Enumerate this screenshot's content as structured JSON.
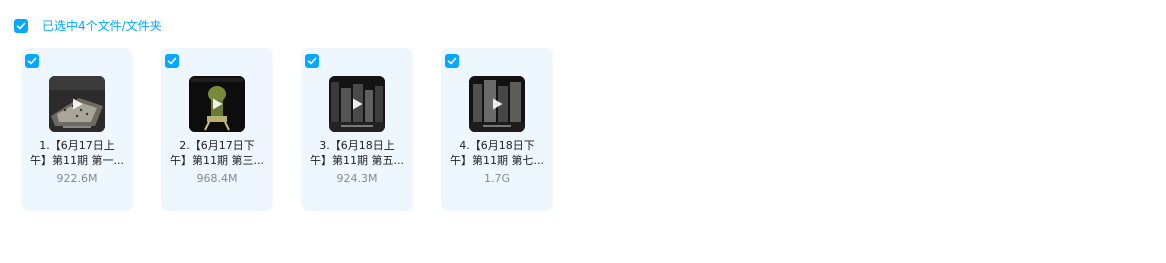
{
  "toolbar": {
    "selection_label": "已选中4个文件/文件夹",
    "all_checked": true
  },
  "colors": {
    "accent": "#06a7ff",
    "card_bg": "#eef7fe",
    "size_text": "#818999"
  },
  "files": [
    {
      "name_line1": "1.【6月17日上",
      "name_line2": "午】第11期 第一...",
      "size": "922.6M",
      "checked": true,
      "type": "video",
      "thumb_icon": "video-thumbnail-icon"
    },
    {
      "name_line1": "2.【6月17日下",
      "name_line2": "午】第11期 第三...",
      "size": "968.4M",
      "checked": true,
      "type": "video",
      "thumb_icon": "video-thumbnail-icon"
    },
    {
      "name_line1": "3.【6月18日上",
      "name_line2": "午】第11期 第五...",
      "size": "924.3M",
      "checked": true,
      "type": "video",
      "thumb_icon": "video-thumbnail-icon"
    },
    {
      "name_line1": "4.【6月18日下",
      "name_line2": "午】第11期 第七...",
      "size": "1.7G",
      "checked": true,
      "type": "video",
      "thumb_icon": "video-thumbnail-icon"
    }
  ]
}
